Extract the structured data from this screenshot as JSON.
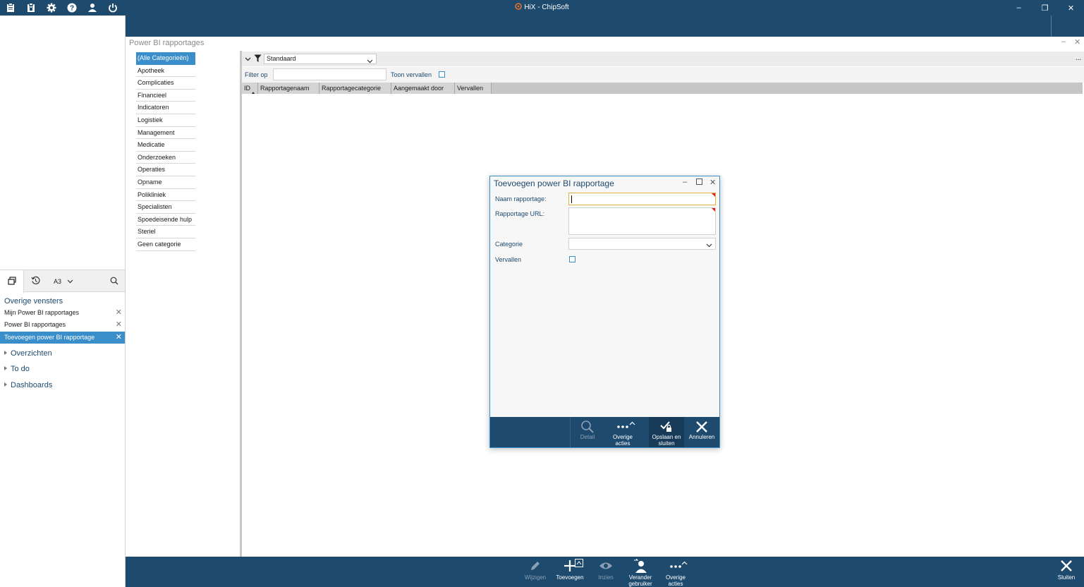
{
  "window": {
    "title": "HiX - ChipSoft",
    "minimize_glyph": "–",
    "restore_glyph": "❐",
    "close_glyph": "✕"
  },
  "toolbar_icons": [
    "clipboard-icon",
    "lock-clipboard-icon",
    "gear-icon",
    "help-icon",
    "user-icon",
    "power-icon"
  ],
  "module": {
    "title": "Power BI rapportages",
    "minimize_glyph": "–",
    "close_glyph": "✕"
  },
  "categories": [
    "(Alle Categorieën)",
    "Apotheek",
    "Complicaties",
    "Financieel",
    "Indicatoren",
    "Logistiek",
    "Management",
    "Medicatie",
    "Onderzoeken",
    "Operaties",
    "Opname",
    "Polikliniek",
    "Specialisten",
    "Spoedeisende hulp",
    "Steriel",
    "Geen categorie"
  ],
  "grid": {
    "view_selected": "Standaard",
    "filter_label": "Filter op",
    "filter_value": "",
    "show_expired_label": "Toon vervallen",
    "more_glyph": "...",
    "columns": [
      "ID",
      "Rapportagenaam",
      "Rapportagecategorie",
      "Aangemaakt door",
      "Vervallen"
    ]
  },
  "left_panel": {
    "tab_a3_label": "A3",
    "windows_title": "Overige vensters",
    "windows": [
      {
        "label": "Mijn Power BI rapportages",
        "active": false
      },
      {
        "label": "Power BI rapportages",
        "active": false
      },
      {
        "label": "Toevoegen power BI rapportage",
        "active": true
      }
    ],
    "groups": [
      "Overzichten",
      "To do",
      "Dashboards"
    ]
  },
  "dialog": {
    "title": "Toevoegen power BI rapportage",
    "fields": {
      "name_label": "Naam rapportage:",
      "name_value": "",
      "url_label": "Rapportage URL:",
      "url_value": "",
      "category_label": "Categorie",
      "category_value": "",
      "expired_label": "Vervallen"
    },
    "actions": {
      "detail": "Detail",
      "more_line1": "Overige",
      "more_line2": "acties",
      "save_line1": "Opslaan en",
      "save_line2": "sluiten",
      "cancel": "Annuleren"
    }
  },
  "bottom_actions": {
    "edit": "Wijzigen",
    "add": "Toevoegen",
    "view": "Inzien",
    "change_user_line1": "Verander",
    "change_user_line2": "gebruiker",
    "more_line1": "Overige",
    "more_line2": "acties",
    "close": "Sluiten"
  },
  "colors": {
    "brand_dark": "#1e4a6e",
    "accent": "#3a8ec9",
    "required": "#e02020"
  }
}
